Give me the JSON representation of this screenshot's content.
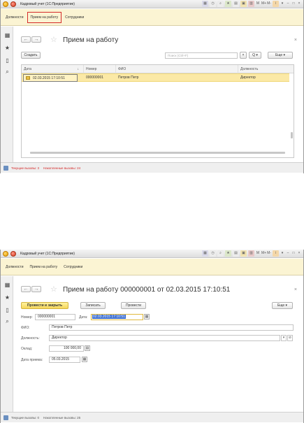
{
  "window1": {
    "title": "Кадровый учет (1С:Предприятие)",
    "sections": [
      {
        "label": "Должности"
      },
      {
        "label": "Прием на работу"
      },
      {
        "label": "Сотрудники"
      }
    ],
    "form": {
      "title": "Прием на работу",
      "create_label": "Создать",
      "search_placeholder": "Поиск (Ctrl+F)",
      "search_clear": "×",
      "search_btn": "Q ▾",
      "more_label": "Еще ▾",
      "columns": [
        "Дата",
        "Номер",
        "ФИО",
        "Должность"
      ],
      "sort_indicator": "↓",
      "rows": [
        {
          "date": "02.03.2015 17:10:51",
          "number": "000000001",
          "name": "Петров Петр",
          "position": "Директор"
        }
      ]
    },
    "status": {
      "current_calls": "Текущие вызовы: 3",
      "accumulated_calls": "Накопленные вызовы: 24"
    },
    "toolbar_icons": [
      "M",
      "M+",
      "M-",
      "i"
    ]
  },
  "window2": {
    "title": "Кадровый учет (1С:Предприятие)",
    "sections": [
      {
        "label": "Должности"
      },
      {
        "label": "Прием на работу"
      },
      {
        "label": "Сотрудники"
      }
    ],
    "form": {
      "title": "Прием на работу 000000001 от 02.03.2015 17:10:51",
      "post_close_label": "Провести и закрыть",
      "save_label": "Записать",
      "post_label": "Провести",
      "more_label": "Еще ▾",
      "number_label": "Номер:",
      "number_value": "000000001",
      "date_label": "Дата:",
      "date_value": "02.03.2015 17:10:51",
      "fio_label": "ФИО:",
      "fio_value": "Петров Петр",
      "position_label": "Должность:",
      "position_value": "Директор",
      "salary_label": "Оклад:",
      "salary_value": "100 000,00",
      "hire_date_label": "Дата приема:",
      "hire_date_value": "05.03.2015"
    },
    "status": {
      "current_calls": "Текущие вызовы: 0",
      "accumulated_calls": "Накопленные вызовы: 25"
    },
    "toolbar_icons": [
      "M",
      "M+",
      "M-",
      "i"
    ]
  },
  "colors": {
    "accent_yellow": "#fbf4d3",
    "row_highlight": "#fbe9a6",
    "primary_button": "#f5d65a",
    "active_section_border": "#d42a2a",
    "status_red": "#d42a2a"
  }
}
